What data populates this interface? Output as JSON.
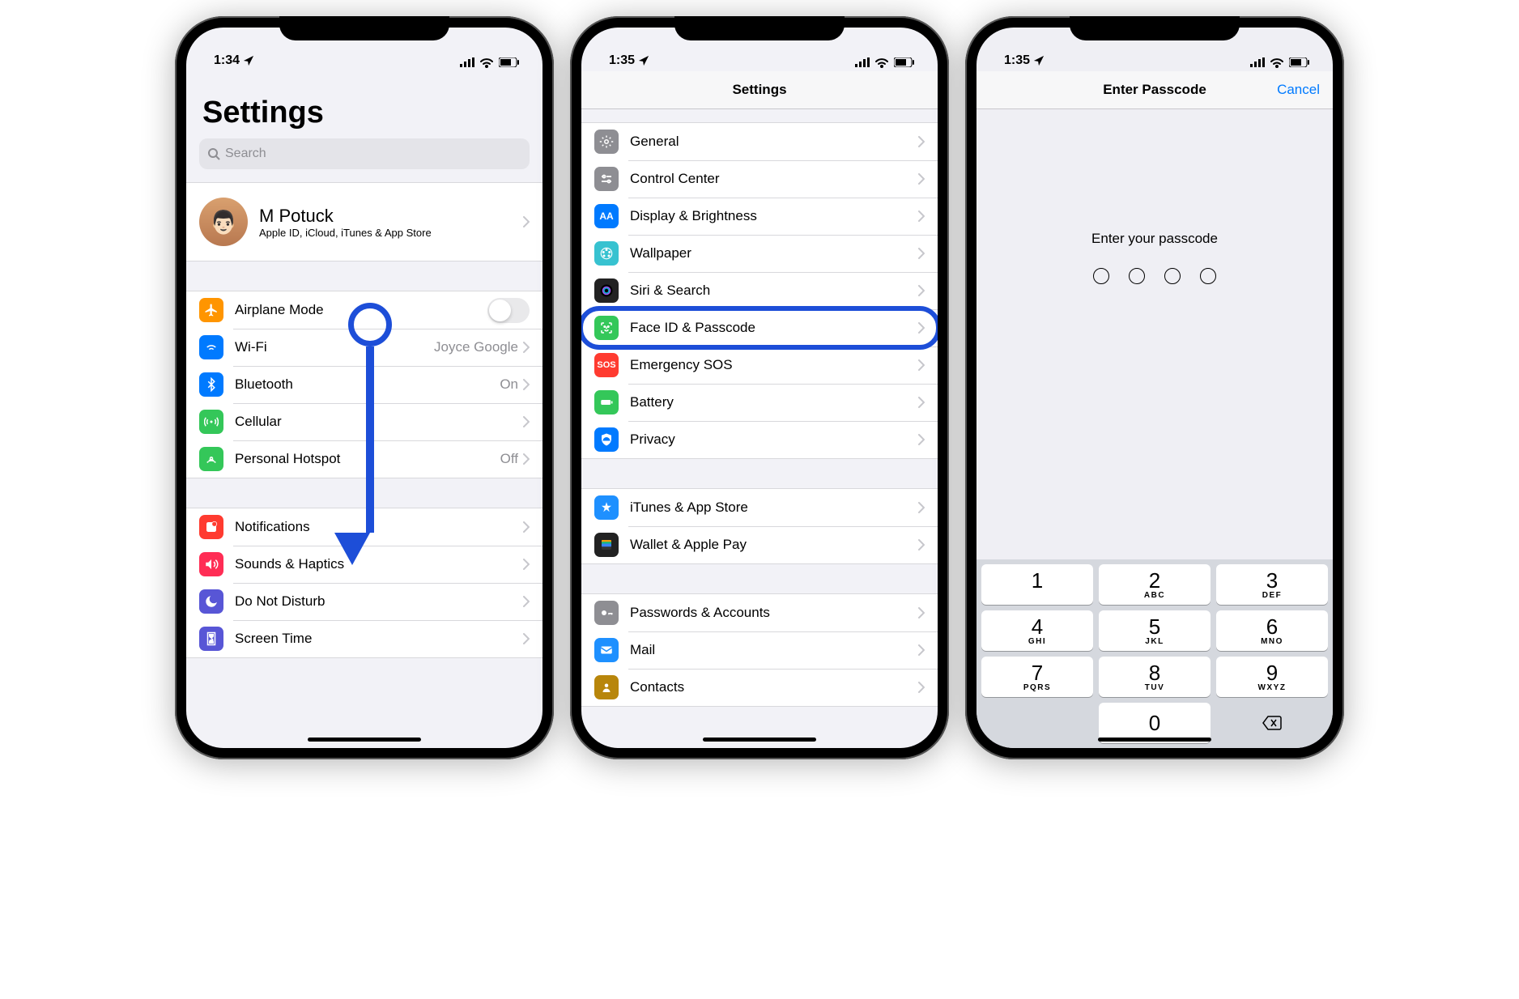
{
  "phone1": {
    "time": "1:34",
    "title": "Settings",
    "search_placeholder": "Search",
    "profile": {
      "name": "M Potuck",
      "sub": "Apple ID, iCloud, iTunes & App Store"
    },
    "group1": [
      {
        "key": "airplane",
        "label": "Airplane Mode",
        "toggle": false,
        "color": "#ff9500"
      },
      {
        "key": "wifi",
        "label": "Wi-Fi",
        "detail": "Joyce Google",
        "color": "#007aff"
      },
      {
        "key": "bluetooth",
        "label": "Bluetooth",
        "detail": "On",
        "color": "#007aff"
      },
      {
        "key": "cellular",
        "label": "Cellular",
        "color": "#34c759"
      },
      {
        "key": "hotspot",
        "label": "Personal Hotspot",
        "detail": "Off",
        "color": "#34c759"
      }
    ],
    "group2": [
      {
        "key": "notifications",
        "label": "Notifications",
        "color": "#ff3b30"
      },
      {
        "key": "sounds",
        "label": "Sounds & Haptics",
        "color": "#ff2d55"
      },
      {
        "key": "dnd",
        "label": "Do Not Disturb",
        "color": "#5856d6"
      },
      {
        "key": "screentime",
        "label": "Screen Time",
        "color": "#5856d6"
      }
    ]
  },
  "phone2": {
    "time": "1:35",
    "title": "Settings",
    "group1": [
      {
        "key": "general",
        "label": "General",
        "color": "#8e8e93"
      },
      {
        "key": "control",
        "label": "Control Center",
        "color": "#8e8e93"
      },
      {
        "key": "display",
        "label": "Display & Brightness",
        "color": "#007aff"
      },
      {
        "key": "wallpaper",
        "label": "Wallpaper",
        "color": "#37c2d0"
      },
      {
        "key": "siri",
        "label": "Siri & Search",
        "color": "#222"
      },
      {
        "key": "faceid",
        "label": "Face ID & Passcode",
        "color": "#34c759",
        "highlight": true
      },
      {
        "key": "sos",
        "label": "Emergency SOS",
        "color": "#ff3b30"
      },
      {
        "key": "battery",
        "label": "Battery",
        "color": "#34c759"
      },
      {
        "key": "privacy",
        "label": "Privacy",
        "color": "#007aff"
      }
    ],
    "group2": [
      {
        "key": "itunes",
        "label": "iTunes & App Store",
        "color": "#1e90ff"
      },
      {
        "key": "wallet",
        "label": "Wallet & Apple Pay",
        "color": "#222"
      }
    ],
    "group3": [
      {
        "key": "passwords",
        "label": "Passwords & Accounts",
        "color": "#8e8e93"
      },
      {
        "key": "mail",
        "label": "Mail",
        "color": "#1e90ff"
      },
      {
        "key": "contacts",
        "label": "Contacts",
        "color": "#b8860b"
      }
    ]
  },
  "phone3": {
    "time": "1:35",
    "title": "Enter Passcode",
    "cancel": "Cancel",
    "prompt": "Enter your passcode",
    "dots": 4,
    "keypad": [
      {
        "n": "1",
        "l": ""
      },
      {
        "n": "2",
        "l": "ABC"
      },
      {
        "n": "3",
        "l": "DEF"
      },
      {
        "n": "4",
        "l": "GHI"
      },
      {
        "n": "5",
        "l": "JKL"
      },
      {
        "n": "6",
        "l": "MNO"
      },
      {
        "n": "7",
        "l": "PQRS"
      },
      {
        "n": "8",
        "l": "TUV"
      },
      {
        "n": "9",
        "l": "WXYZ"
      }
    ],
    "zero": "0"
  }
}
